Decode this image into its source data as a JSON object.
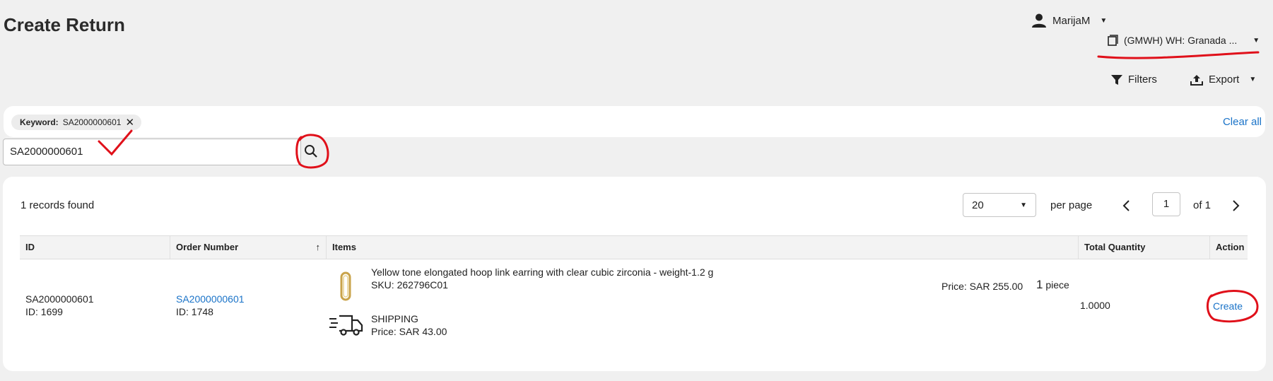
{
  "page": {
    "title": "Create Return"
  },
  "header": {
    "user_name": "MarijaM",
    "warehouse": "(GMWH) WH: Granada ..."
  },
  "toolbar": {
    "filters_label": "Filters",
    "export_label": "Export"
  },
  "filters": {
    "chip_key": "Keyword:",
    "chip_value": "SA2000000601",
    "clear_all_label": "Clear all",
    "search_value": "SA2000000601"
  },
  "results": {
    "records_text": "1 records found",
    "per_page_value": "20",
    "per_page_label": "per page",
    "page_number": "1",
    "page_of": "of 1"
  },
  "table": {
    "columns": {
      "id": "ID",
      "order_number": "Order Number",
      "items": "Items",
      "total_quantity": "Total Quantity",
      "action": "Action"
    },
    "rows": [
      {
        "id": "SA2000000601",
        "id_sub": "ID: 1699",
        "order_number": "SA2000000601",
        "order_sub": "ID: 1748",
        "item_name": "Yellow tone elongated hoop link earring with clear cubic zirconia - weight-1.2 g",
        "item_sku": "SKU: 262796C01",
        "item_price": "Price: SAR 255.00",
        "item_qty": "1",
        "item_qty_unit": "piece",
        "shipping_label": "SHIPPING",
        "shipping_price": "Price: SAR 43.00",
        "total_quantity": "1.0000",
        "action_label": "Create"
      }
    ]
  },
  "colors": {
    "accent": "#1a73c8",
    "annotation": "#e0101a"
  }
}
